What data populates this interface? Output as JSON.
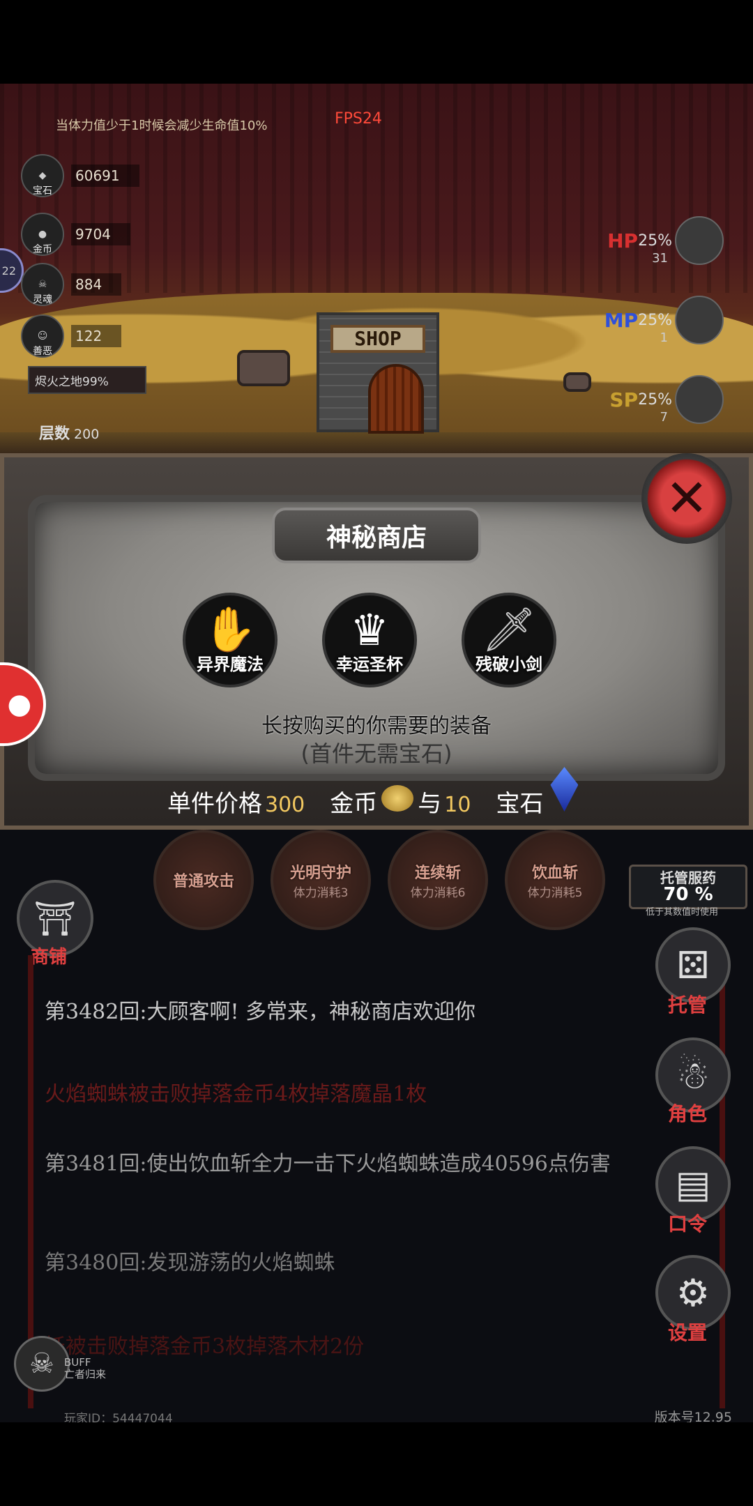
{
  "hud": {
    "tip": "当体力值少于1时候会减少生命值10%",
    "fps": "FPS24",
    "resources": [
      {
        "icon": "gem-icon",
        "label": "宝石",
        "value": "60691"
      },
      {
        "icon": "gold-coin-icon",
        "label": "金币",
        "value": "9704"
      },
      {
        "icon": "skull-icon",
        "label": "灵魂",
        "value": "884"
      },
      {
        "icon": "mask-icon",
        "label": "善恶",
        "value": "122"
      }
    ],
    "floor_banner": "烬火之地99%",
    "floor_label": "层数",
    "floor_value": "200",
    "hp": {
      "label": "HP",
      "pct": "25%",
      "count": "31",
      "color": "#d83030"
    },
    "mp": {
      "label": "MP",
      "pct": "25%",
      "count": "1",
      "color": "#3050d8"
    },
    "sp": {
      "label": "SP",
      "pct": "25%",
      "count": "7",
      "color": "#c8a030"
    },
    "left_bubble": "22"
  },
  "shop_sign": "SHOP",
  "dialog": {
    "title": "神秘商店",
    "close": "✕",
    "items": [
      {
        "icon": "otherworld-magic-icon",
        "label": "异界魔法"
      },
      {
        "icon": "lucky-grail-icon",
        "label": "幸运圣杯"
      },
      {
        "icon": "broken-sword-icon",
        "label": "残破小剑"
      }
    ],
    "instruction": "长按购买的你需要的装备",
    "note": "(首件无需宝石)",
    "price_label": "单件价格",
    "price_value": "300",
    "currency_gold": "金币",
    "and": "与",
    "gem_count": "10",
    "currency_gem": "宝石"
  },
  "skills": [
    {
      "name": "普通攻击",
      "cost": ""
    },
    {
      "name": "光明守护",
      "cost": "体力消耗3"
    },
    {
      "name": "连续斩",
      "cost": "体力消耗6"
    },
    {
      "name": "饮血斩",
      "cost": "体力消耗5"
    }
  ],
  "autopot": {
    "title": "托管服药",
    "pct": "70 %",
    "note": "低于其数值时使用"
  },
  "shop_button_label": "商铺",
  "side_buttons": [
    {
      "icon": "dice-icon",
      "label": "托管"
    },
    {
      "icon": "hooded-character-icon",
      "label": "角色"
    },
    {
      "icon": "book-icon",
      "label": "口令"
    },
    {
      "icon": "gear-icon",
      "label": "设置"
    }
  ],
  "log": [
    {
      "text": "第3482回:大顾客啊! 多常来，神秘商店欢迎你",
      "color": "#c8c8c8"
    },
    {
      "text": "火焰蜘蛛被击败掉落金币4枚掉落魔晶1枚",
      "color": "#6a1a1a"
    },
    {
      "text": "第3481回:使出饮血斩全力一击下火焰蜘蛛造成40596点伤害",
      "color": "#9a9a9a"
    },
    {
      "text": "第3480回:发现游荡的火焰蜘蛛",
      "color": "#7a7a7a"
    },
    {
      "text": "妖被击败掉落金币3枚掉落木材2份",
      "color": "#4a1414"
    }
  ],
  "buff": {
    "title": "BUFF",
    "name": "亡者归来"
  },
  "footer": {
    "left": "玩家ID：54447044",
    "right": "版本号12.95"
  }
}
